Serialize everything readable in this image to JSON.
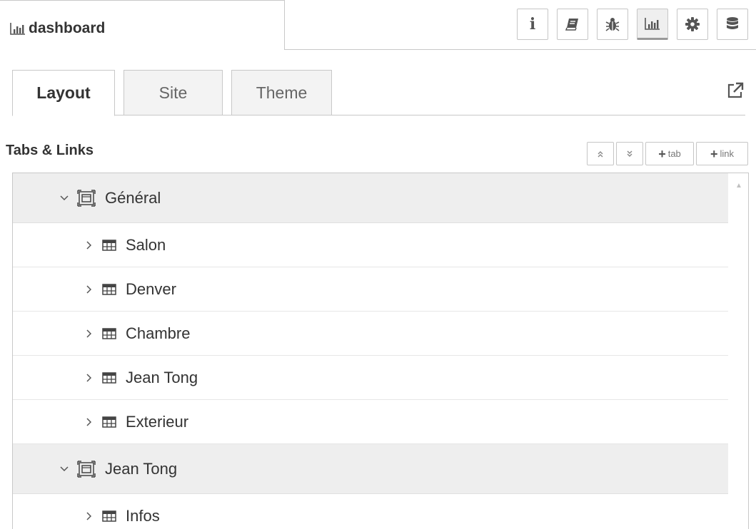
{
  "sidebar": {
    "title": "dashboard",
    "title_icon": "bar-chart-icon"
  },
  "toolbar": {
    "buttons": [
      {
        "name": "info",
        "glyph": "i"
      },
      {
        "name": "help-book"
      },
      {
        "name": "debug-bug"
      },
      {
        "name": "dashboard-chart",
        "active": true
      },
      {
        "name": "config-gear"
      },
      {
        "name": "context-database"
      }
    ]
  },
  "subtabs": {
    "layout": "Layout",
    "site": "Site",
    "theme": "Theme"
  },
  "section": {
    "title": "Tabs & Links",
    "expand_all": "«",
    "collapse_all": "»",
    "add_tab": "tab",
    "add_link": "link",
    "plus": "+"
  },
  "tree": {
    "tab1": {
      "label": "Général",
      "groups": [
        "Salon",
        "Denver",
        "Chambre",
        "Jean Tong",
        "Exterieur"
      ]
    },
    "tab2": {
      "label": "Jean Tong",
      "groups": [
        "Infos"
      ]
    }
  },
  "colors": {
    "border": "#c8c8c8",
    "tab_row_bg": "#eeeeee",
    "text": "#333333"
  }
}
